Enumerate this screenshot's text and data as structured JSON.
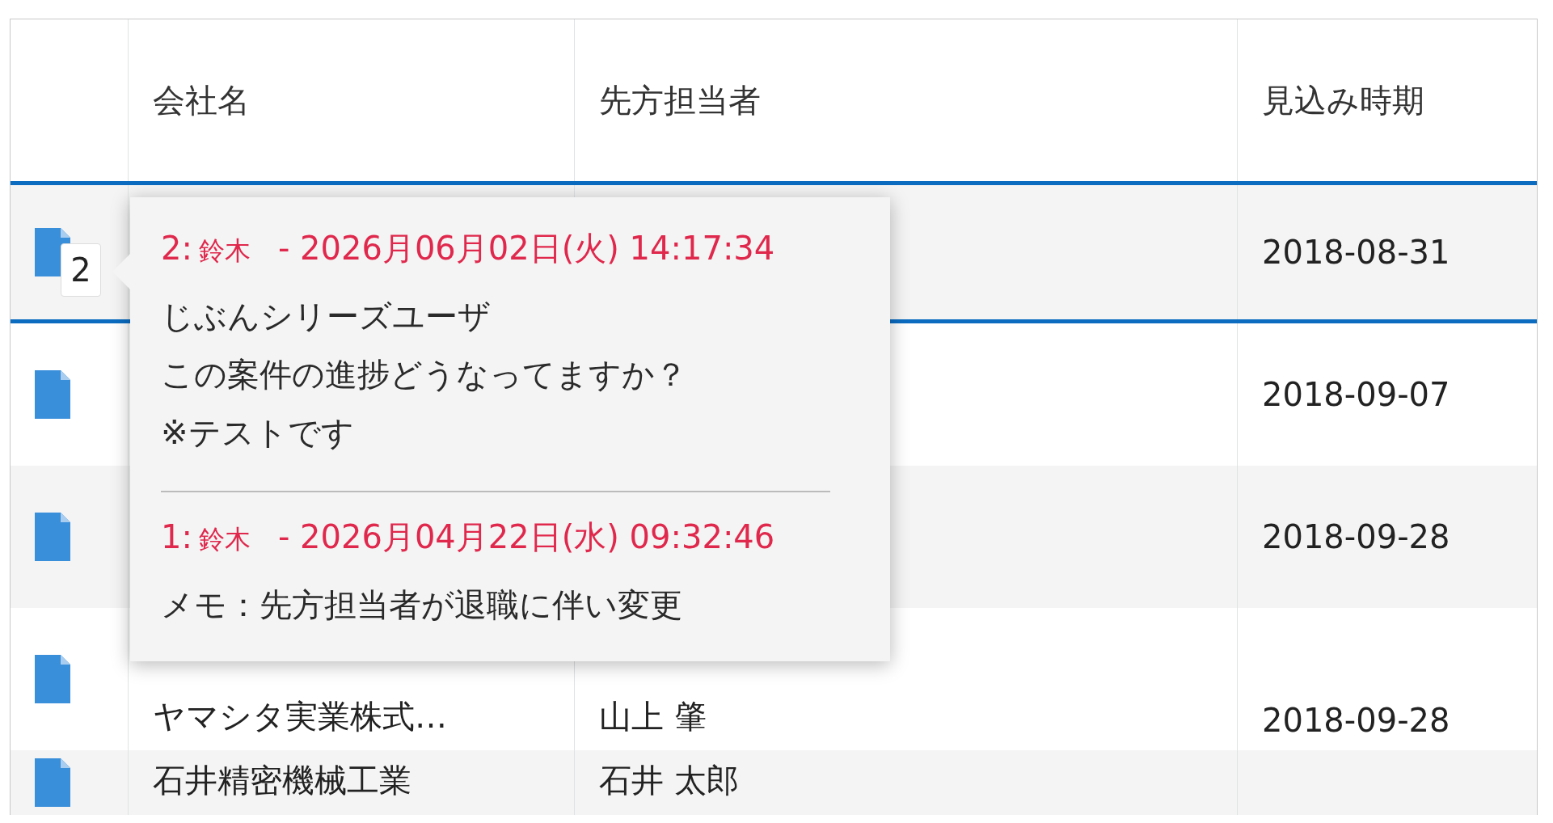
{
  "table": {
    "columns": [
      {
        "label": "会社名"
      },
      {
        "label": "先方担当者"
      },
      {
        "label": "見込み時期"
      }
    ],
    "rows": [
      {
        "selected": true,
        "date": "2018-08-31"
      },
      {
        "selected": false,
        "date": "2018-09-07"
      },
      {
        "selected": false,
        "date": "2018-09-28"
      },
      {
        "selected": false,
        "company": "ヤマシタ実業株式…",
        "contact": "山上 肇",
        "date": "2018-09-28"
      },
      {
        "selected": false,
        "company": "石井精密機械工業",
        "contact": "石井 太郎"
      }
    ]
  },
  "comment_popup": {
    "badge": "2",
    "comments": [
      {
        "number": "2:",
        "author": "鈴木",
        "timestamp": "- 2026月06月02日(火) 14:17:34",
        "lines": [
          "じぶんシリーズユーザ",
          "この案件の進捗どうなってますか？",
          "※テストです"
        ]
      },
      {
        "number": "1:",
        "author": "鈴木",
        "timestamp": "- 2026月04月22日(水) 09:32:46",
        "lines": [
          "メモ：先方担当者が退職に伴い変更"
        ]
      }
    ]
  }
}
